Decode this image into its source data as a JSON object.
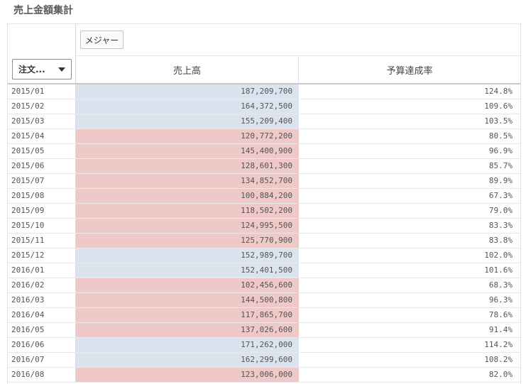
{
  "title": "売上金額集計",
  "pivot": {
    "measure_button_label": "メジャー",
    "dimension_label": "注文...",
    "columns": {
      "sales": "売上高",
      "budget": "予算達成率"
    },
    "colors": {
      "above_budget": "#dbe4ee",
      "below_budget": "#efc8c8"
    },
    "rows": [
      {
        "month": "2015/01",
        "sales": "187,209,700",
        "rate": "124.8%",
        "status": "good"
      },
      {
        "month": "2015/02",
        "sales": "164,372,500",
        "rate": "109.6%",
        "status": "good"
      },
      {
        "month": "2015/03",
        "sales": "155,209,400",
        "rate": "103.5%",
        "status": "good"
      },
      {
        "month": "2015/04",
        "sales": "120,772,200",
        "rate": "80.5%",
        "status": "bad"
      },
      {
        "month": "2015/05",
        "sales": "145,400,900",
        "rate": "96.9%",
        "status": "bad"
      },
      {
        "month": "2015/06",
        "sales": "128,601,300",
        "rate": "85.7%",
        "status": "bad"
      },
      {
        "month": "2015/07",
        "sales": "134,852,700",
        "rate": "89.9%",
        "status": "bad"
      },
      {
        "month": "2015/08",
        "sales": "100,884,200",
        "rate": "67.3%",
        "status": "bad"
      },
      {
        "month": "2015/09",
        "sales": "118,502,200",
        "rate": "79.0%",
        "status": "bad"
      },
      {
        "month": "2015/10",
        "sales": "124,995,500",
        "rate": "83.3%",
        "status": "bad"
      },
      {
        "month": "2015/11",
        "sales": "125,770,900",
        "rate": "83.8%",
        "status": "bad"
      },
      {
        "month": "2015/12",
        "sales": "152,989,700",
        "rate": "102.0%",
        "status": "good"
      },
      {
        "month": "2016/01",
        "sales": "152,401,500",
        "rate": "101.6%",
        "status": "good"
      },
      {
        "month": "2016/02",
        "sales": "102,456,600",
        "rate": "68.3%",
        "status": "bad"
      },
      {
        "month": "2016/03",
        "sales": "144,500,800",
        "rate": "96.3%",
        "status": "bad"
      },
      {
        "month": "2016/04",
        "sales": "117,865,700",
        "rate": "78.6%",
        "status": "bad"
      },
      {
        "month": "2016/05",
        "sales": "137,026,600",
        "rate": "91.4%",
        "status": "bad"
      },
      {
        "month": "2016/06",
        "sales": "171,262,000",
        "rate": "114.2%",
        "status": "good"
      },
      {
        "month": "2016/07",
        "sales": "162,299,600",
        "rate": "108.2%",
        "status": "good"
      },
      {
        "month": "2016/08",
        "sales": "123,006,000",
        "rate": "82.0%",
        "status": "bad"
      }
    ]
  }
}
